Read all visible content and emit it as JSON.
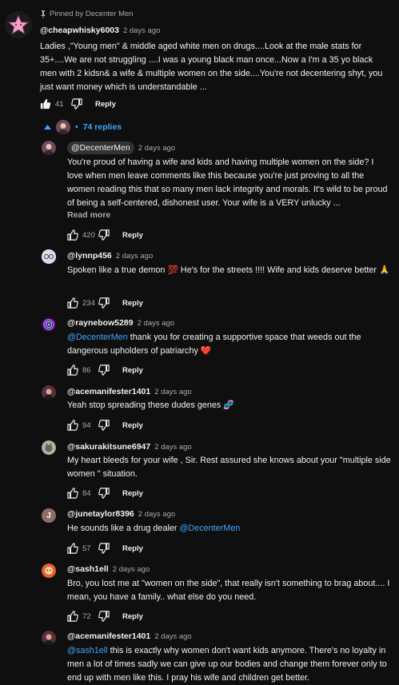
{
  "pinned": {
    "pin_text": "Pinned by Decenter Men",
    "author": "@cheapwhisky6003",
    "time": "2 days ago",
    "text": "Ladies ,\"Young men\"  & middle aged white men on drugs....Look at the male stats for 35+....We are not struggling ....I was a young black man once...Now a I'm a 35 yo black men with 2 kidsn& a wife & multiple women on the side....You're not decentering shyt, you just want money which is understandable ...",
    "likes": "41",
    "reply_label": "Reply"
  },
  "replies_toggle": {
    "label": "74 replies"
  },
  "replies": [
    {
      "author": "@DecenterMen",
      "time": "2 days ago",
      "text": "You're proud of having a wife and kids and having multiple women on the side?  I love when men leave comments like this because you're just proving to all the women reading this that so many men lack integrity and morals.  It's wild to be proud of being a self-centered, dishonest user.  Your wife is a VERY unlucky ...",
      "read_more": "Read more",
      "likes": "420",
      "reply_label": "Reply"
    },
    {
      "author": "@lynnp456",
      "time": "2 days ago",
      "text_a": "Spoken like a true demon ",
      "emoji_a": "💯",
      "text_b": " He's for the streets !!!! Wife and kids deserve better ",
      "emoji_b": "🙏",
      "likes": "234",
      "reply_label": "Reply"
    },
    {
      "author": "@raynebow5289",
      "time": "2 days ago",
      "mention": "@DecenterMen",
      "text": " thank you for creating a supportive space that weeds out the dangerous upholders of patriarchy ",
      "emoji": "❤️",
      "likes": "86",
      "reply_label": "Reply"
    },
    {
      "author": "@acemanifester1401",
      "time": "2 days ago",
      "text": "Yeah stop spreading these dudes genes ",
      "emoji": "🧬",
      "likes": "94",
      "reply_label": "Reply"
    },
    {
      "author": "@sakurakitsune6947",
      "time": "2 days ago",
      "text": "My heart bleeds for your wife , Sir. Rest assured she knows about your \"multiple side women \" situation.",
      "likes": "84",
      "reply_label": "Reply"
    },
    {
      "author": "@junetaylor8396",
      "time": "2 days ago",
      "avatar_letter": "J",
      "text": "He sounds like a drug dealer ",
      "mention": "@DecenterMen",
      "likes": "57",
      "reply_label": "Reply"
    },
    {
      "author": "@sash1ell",
      "time": "2 days ago",
      "text": "Bro, you lost me at \"women on the side\", that really isn't something to brag about.... I mean, you have a family.. what else do you need.",
      "likes": "72",
      "reply_label": "Reply"
    },
    {
      "author": "@acemanifester1401",
      "time": "2 days ago",
      "mention": "@sash1ell",
      "text": "  this is exactly why women don't want kids anymore. There's no loyalty in men a lot of times sadly we can give up our bodies and change them forever only to end up with men like this. I pray his wife and children get better."
    }
  ],
  "colors": {
    "background": "#0f0f0f",
    "text": "#f1f1f1",
    "muted": "#aaaaaa",
    "link": "#3ea6ff"
  }
}
